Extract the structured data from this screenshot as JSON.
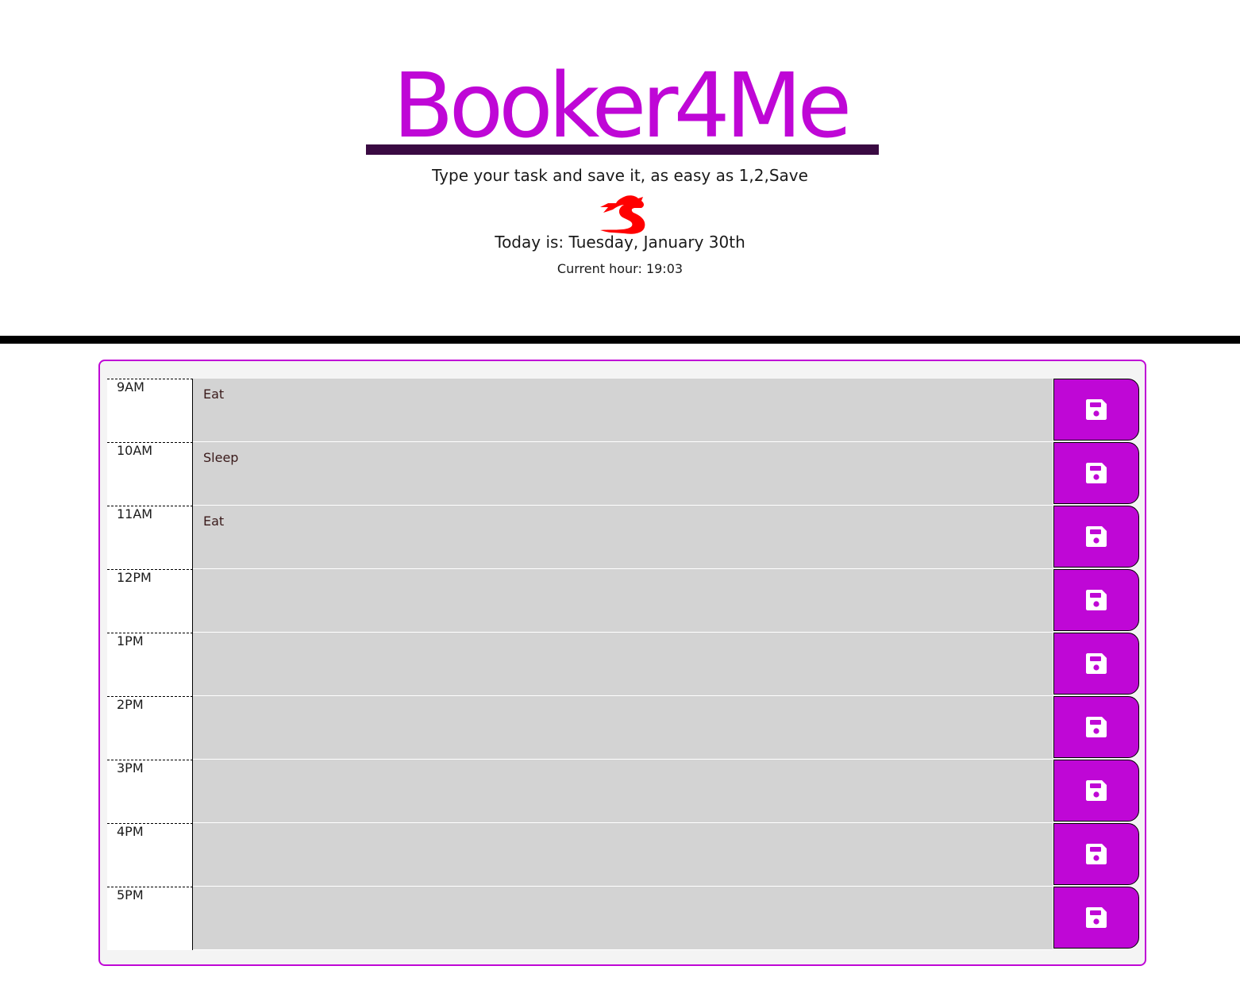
{
  "header": {
    "title": "Booker4Me",
    "tagline": "Type your task and save it, as easy as 1,2,Save",
    "logo_icon": "dragon-icon",
    "today_label": "Today is: Tuesday, January 30th",
    "current_hour_label": "Current hour: 19:03"
  },
  "colors": {
    "accent": "#bf07d6",
    "underline": "#3a0a42",
    "logo": "#ff0000",
    "task_background": "#d3d3d3"
  },
  "planner": {
    "save_icon": "floppy-disk-icon",
    "rows": [
      {
        "hour": "9AM",
        "task": "Eat"
      },
      {
        "hour": "10AM",
        "task": "Sleep"
      },
      {
        "hour": "11AM",
        "task": "Eat"
      },
      {
        "hour": "12PM",
        "task": ""
      },
      {
        "hour": "1PM",
        "task": ""
      },
      {
        "hour": "2PM",
        "task": ""
      },
      {
        "hour": "3PM",
        "task": ""
      },
      {
        "hour": "4PM",
        "task": ""
      },
      {
        "hour": "5PM",
        "task": ""
      }
    ]
  }
}
